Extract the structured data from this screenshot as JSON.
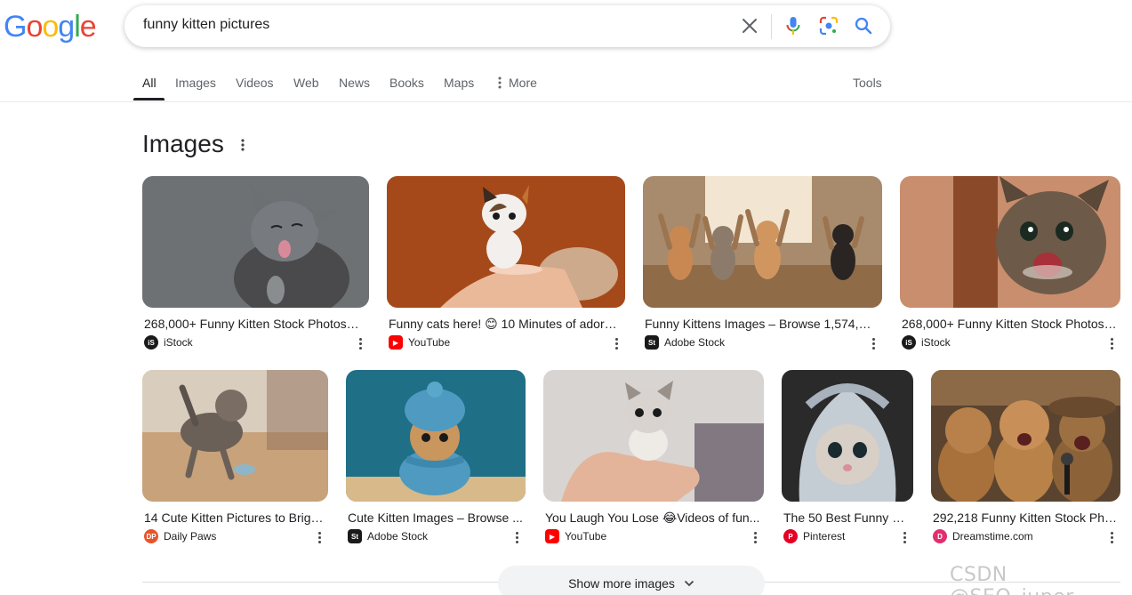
{
  "header": {
    "logo_letters": [
      "G",
      "o",
      "o",
      "g",
      "l",
      "e"
    ],
    "logo_colors": [
      "#4285F4",
      "#EA4335",
      "#FBBC05",
      "#4285F4",
      "#34A853",
      "#EA4335"
    ],
    "search_query": "funny kitten pictures",
    "icons": [
      "close-icon",
      "microphone-icon",
      "lens-icon",
      "search-icon"
    ]
  },
  "tabs": [
    {
      "label": "All",
      "active": true
    },
    {
      "label": "Images"
    },
    {
      "label": "Videos"
    },
    {
      "label": "Web"
    },
    {
      "label": "News"
    },
    {
      "label": "Books"
    },
    {
      "label": "Maps"
    },
    {
      "label": "More",
      "icon": "more-vert-icon"
    }
  ],
  "tools_label": "Tools",
  "section": {
    "title": "Images",
    "menu_icon": "more-vert-icon"
  },
  "images": [
    {
      "title": "268,000+ Funny Kitten Stock Photos, ...",
      "source": "iStock",
      "source_icon": "istock-icon",
      "source_color": "#1a1a1a"
    },
    {
      "title": "Funny cats here! 😊 10 Minutes of adora...",
      "source": "YouTube",
      "source_icon": "youtube-icon",
      "source_color": "#ff0000"
    },
    {
      "title": "Funny Kittens Images – Browse 1,574,50...",
      "source": "Adobe Stock",
      "source_icon": "adobe-stock-icon",
      "source_color": "#1a1a1a"
    },
    {
      "title": "268,000+ Funny Kitten Stock Photos,...",
      "source": "iStock",
      "source_icon": "istock-icon",
      "source_color": "#1a1a1a"
    },
    {
      "title": "14 Cute Kitten Pictures to Brigh...",
      "source": "Daily Paws",
      "source_icon": "daily-paws-icon",
      "source_color": "#e8542a"
    },
    {
      "title": "Cute Kitten Images – Browse ...",
      "source": "Adobe Stock",
      "source_icon": "adobe-stock-icon",
      "source_color": "#1a1a1a"
    },
    {
      "title": "You Laugh You Lose 😂Videos of fun...",
      "source": "YouTube",
      "source_icon": "youtube-icon",
      "source_color": "#ff0000"
    },
    {
      "title": "The 50 Best Funny Ki...",
      "source": "Pinterest",
      "source_icon": "pinterest-icon",
      "source_color": "#e60023"
    },
    {
      "title": "292,218 Funny Kitten Stock Phot...",
      "source": "Dreamstime.com",
      "source_icon": "dreamstime-icon",
      "source_color": "#e0306e"
    }
  ],
  "source_marks": [
    "iS",
    "▶",
    "St",
    "iS",
    "DP",
    "St",
    "▶",
    "P",
    "D"
  ],
  "show_more": {
    "label": "Show more images",
    "icon": "chevron-down-icon"
  },
  "watermark": "CSDN @SEO_juper"
}
